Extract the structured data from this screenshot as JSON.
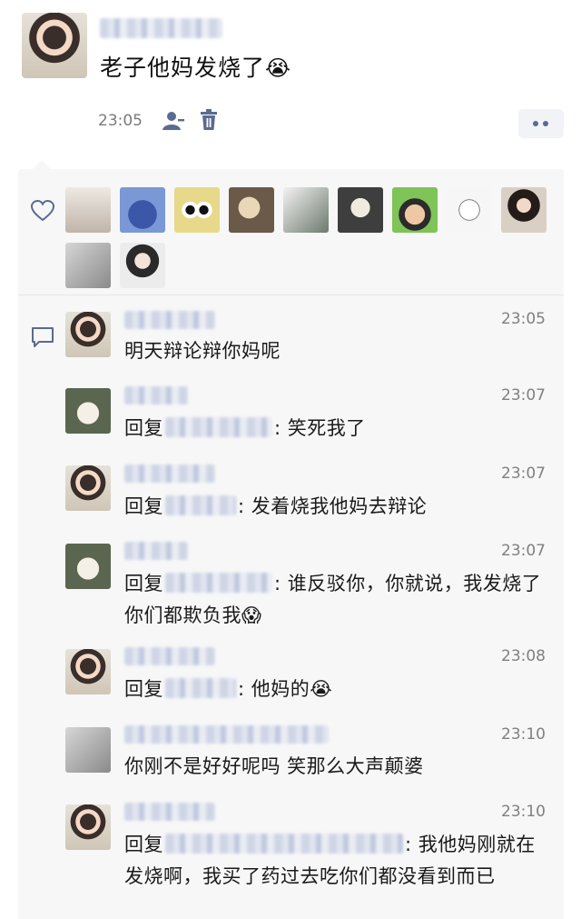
{
  "post": {
    "text": "老子他妈发烧了",
    "emoji": "😭",
    "time": "23:05"
  },
  "comments": [
    {
      "time": "23:05",
      "prefix": "",
      "sep": "",
      "text": "明天辩论辩你妈呢",
      "emoji": ""
    },
    {
      "time": "23:07",
      "prefix": "回复",
      "sep": ":",
      "text": " 笑死我了",
      "emoji": ""
    },
    {
      "time": "23:07",
      "prefix": "回复",
      "sep": ":",
      "text": " 发着烧我他妈去辩论",
      "emoji": ""
    },
    {
      "time": "23:07",
      "prefix": "回复",
      "sep": ":",
      "text": " 谁反驳你，你就说，我发烧了你们都欺负我",
      "emoji": "😱"
    },
    {
      "time": "23:08",
      "prefix": "回复",
      "sep": ":",
      "text": " 他妈的",
      "emoji": "😭"
    },
    {
      "time": "23:10",
      "prefix": "",
      "sep": "",
      "text": "你刚不是好好呢吗 笑那么大声颠婆",
      "emoji": ""
    },
    {
      "time": "23:10",
      "prefix": "回复",
      "sep": ":",
      "text": " 我他妈刚就在发烧啊，我买了药过去吃你们都没看到而已",
      "emoji": ""
    }
  ],
  "colors": {
    "accent": "#5b6a92",
    "panel": "#f7f7f7",
    "time": "#808080"
  },
  "icons": [
    "user-icon",
    "trash-icon",
    "more-icon",
    "heart-icon",
    "comment-icon"
  ]
}
